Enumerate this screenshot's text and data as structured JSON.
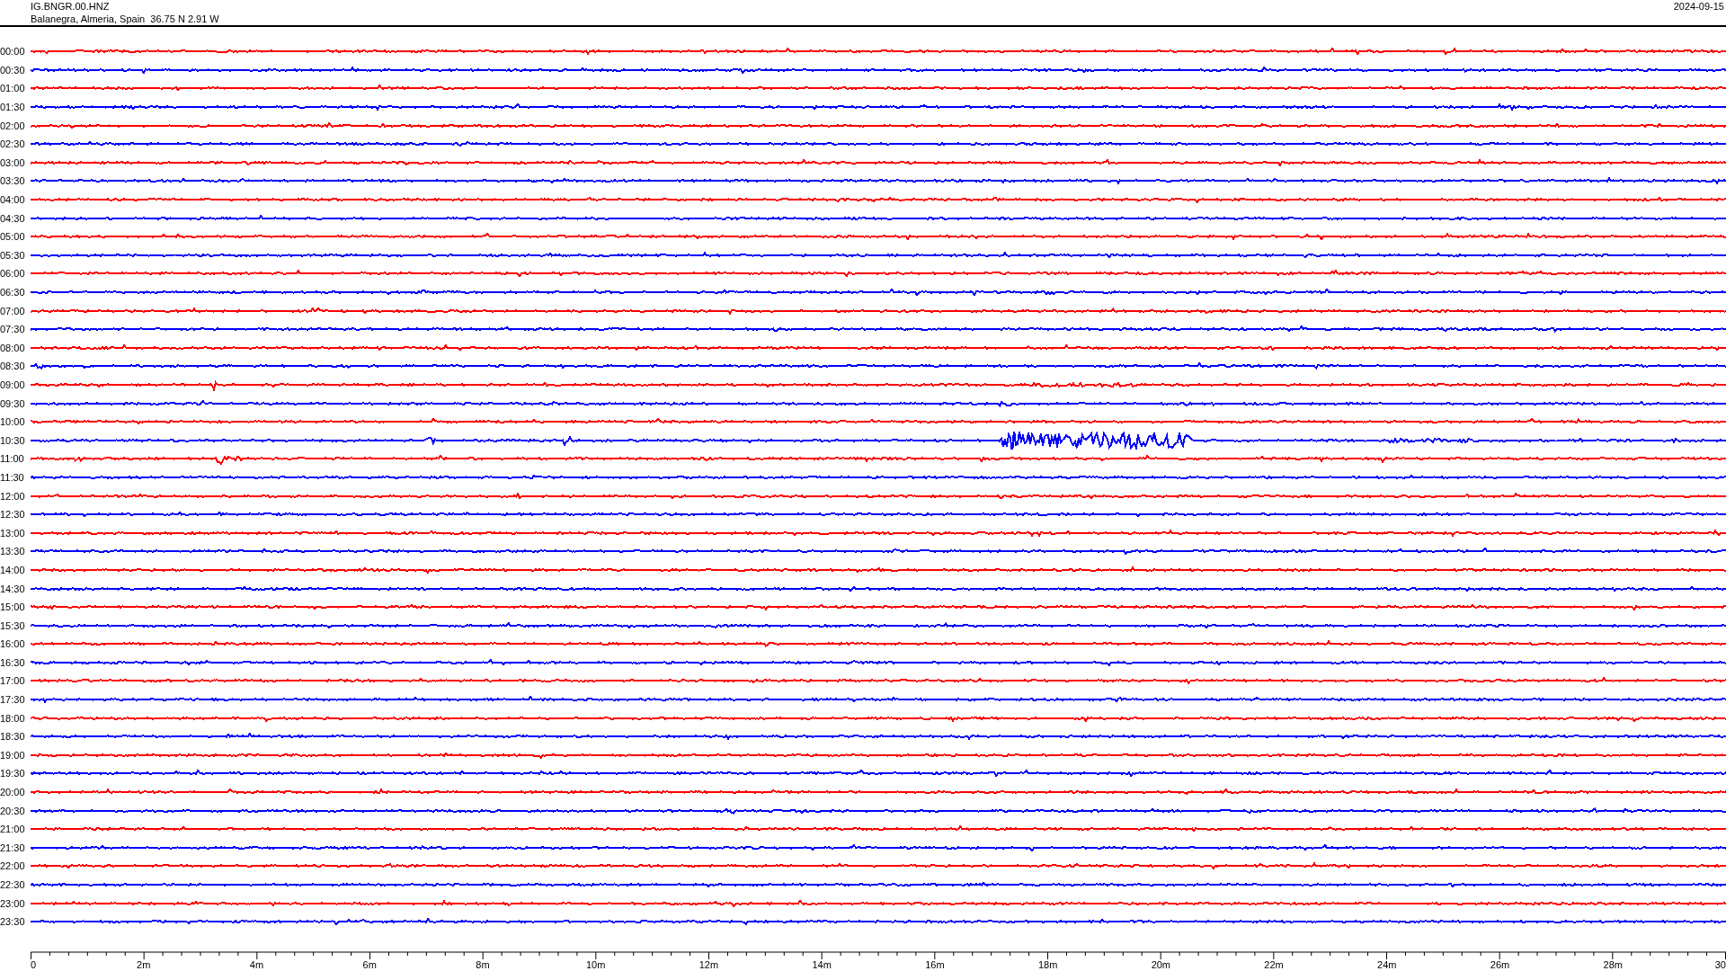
{
  "header": {
    "station": "IG.BNGR.00.HNZ",
    "location": "Balanegra, Almeria, Spain  36.75 N 2.91 W",
    "date": "2024-09-15"
  },
  "traces": [
    {
      "time": "00:00",
      "color": "#ff0000"
    },
    {
      "time": "00:30",
      "color": "#0000ff"
    },
    {
      "time": "01:00",
      "color": "#ff0000"
    },
    {
      "time": "01:30",
      "color": "#0000ff"
    },
    {
      "time": "02:00",
      "color": "#ff0000"
    },
    {
      "time": "02:30",
      "color": "#0000ff"
    },
    {
      "time": "03:00",
      "color": "#ff0000"
    },
    {
      "time": "03:30",
      "color": "#0000ff"
    },
    {
      "time": "04:00",
      "color": "#ff0000"
    },
    {
      "time": "04:30",
      "color": "#0000ff"
    },
    {
      "time": "05:00",
      "color": "#ff0000"
    },
    {
      "time": "05:30",
      "color": "#0000ff"
    },
    {
      "time": "06:00",
      "color": "#ff0000"
    },
    {
      "time": "06:30",
      "color": "#0000ff"
    },
    {
      "time": "07:00",
      "color": "#ff0000"
    },
    {
      "time": "07:30",
      "color": "#0000ff"
    },
    {
      "time": "08:00",
      "color": "#ff0000"
    },
    {
      "time": "08:30",
      "color": "#0000ff"
    },
    {
      "time": "09:00",
      "color": "#ff0000"
    },
    {
      "time": "09:30",
      "color": "#0000ff"
    },
    {
      "time": "10:00",
      "color": "#ff0000"
    },
    {
      "time": "10:30",
      "color": "#0000ff"
    },
    {
      "time": "11:00",
      "color": "#ff0000"
    },
    {
      "time": "11:30",
      "color": "#0000ff"
    },
    {
      "time": "12:00",
      "color": "#ff0000"
    },
    {
      "time": "12:30",
      "color": "#0000ff"
    },
    {
      "time": "13:00",
      "color": "#ff0000"
    },
    {
      "time": "13:30",
      "color": "#0000ff"
    },
    {
      "time": "14:00",
      "color": "#ff0000"
    },
    {
      "time": "14:30",
      "color": "#0000ff"
    },
    {
      "time": "15:00",
      "color": "#ff0000"
    },
    {
      "time": "15:30",
      "color": "#0000ff"
    },
    {
      "time": "16:00",
      "color": "#ff0000"
    },
    {
      "time": "16:30",
      "color": "#0000ff"
    },
    {
      "time": "17:00",
      "color": "#ff0000"
    },
    {
      "time": "17:30",
      "color": "#0000ff"
    },
    {
      "time": "18:00",
      "color": "#ff0000"
    },
    {
      "time": "18:30",
      "color": "#0000ff"
    },
    {
      "time": "19:00",
      "color": "#ff0000"
    },
    {
      "time": "19:30",
      "color": "#0000ff"
    },
    {
      "time": "20:00",
      "color": "#ff0000"
    },
    {
      "time": "20:30",
      "color": "#0000ff"
    },
    {
      "time": "21:00",
      "color": "#ff0000"
    },
    {
      "time": "21:30",
      "color": "#0000ff"
    },
    {
      "time": "22:00",
      "color": "#ff0000"
    },
    {
      "time": "22:30",
      "color": "#0000ff"
    },
    {
      "time": "23:00",
      "color": "#ff0000"
    },
    {
      "time": "23:30",
      "color": "#0000ff"
    }
  ],
  "x_axis": {
    "ticks": [
      "0",
      "2m",
      "4m",
      "6m",
      "8m",
      "10m",
      "12m",
      "14m",
      "16m",
      "18m",
      "20m",
      "22m",
      "24m",
      "26m",
      "28m",
      "30"
    ]
  }
}
